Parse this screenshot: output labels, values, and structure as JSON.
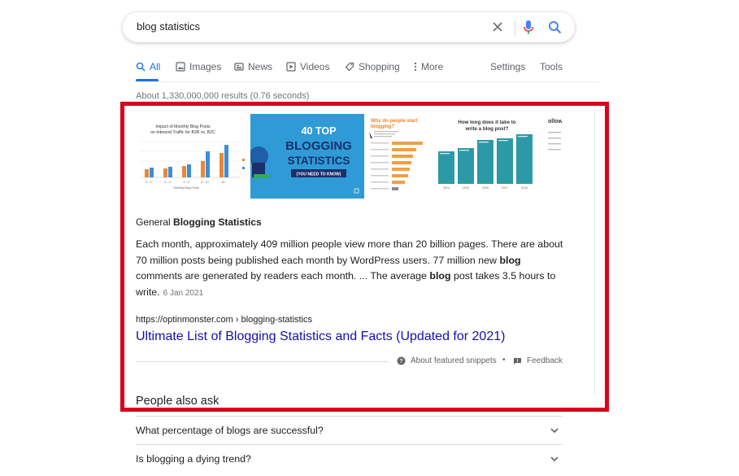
{
  "search": {
    "query": "blog statistics"
  },
  "tabs": [
    {
      "label": "All",
      "icon": "search-icon"
    },
    {
      "label": "Images",
      "icon": "image-icon"
    },
    {
      "label": "News",
      "icon": "news-icon"
    },
    {
      "label": "Videos",
      "icon": "video-icon"
    },
    {
      "label": "Shopping",
      "icon": "tag-icon"
    },
    {
      "label": "More",
      "icon": "more-vert-icon"
    }
  ],
  "tools": {
    "settings": "Settings",
    "tools": "Tools"
  },
  "result_stats": "About 1,330,000,000 results (0.76 seconds)",
  "images": {
    "img1": {
      "title_line1": "Impact of Monthly Blog Posts",
      "title_line2": "on Inbound Traffic for B2B vs. B2C",
      "xlabels": [
        "0 - 1",
        "2 - 3",
        "4 - 5",
        "6 - 10",
        "11+"
      ],
      "xaxis": "Monthly Blog Posts"
    },
    "img2": {
      "line1": "40 TOP",
      "line2": "BLOGGING",
      "line3": "STATISTICS",
      "line4": "(YOU NEED TO KNOW)"
    },
    "img3": {
      "title_line1": "Why do people start",
      "title_line2": "blogging?"
    },
    "img4": {
      "title_line1": "How long does it take to",
      "title_line2": "write a blog post?",
      "years": [
        "2014",
        "2015",
        "2016",
        "2017",
        "2018"
      ]
    },
    "img5": {
      "text": "ollow"
    }
  },
  "snippet": {
    "heading_prefix": "General ",
    "heading_bold": "Blogging Statistics",
    "body_1": "Each month, approximately 409 million people view more than 20 billion pages. There are about 70 million posts being published each month by WordPress users. 77 million new ",
    "bold_1": "blog",
    "body_2": " comments are generated by readers each month. ... The average ",
    "bold_2": "blog",
    "body_3": " post takes 3.5 hours to write.",
    "date": "6 Jan 2021"
  },
  "result": {
    "url": "https://optinmonster.com › blogging-statistics",
    "title": "Ultimate List of Blogging Statistics and Facts (Updated for 2021)"
  },
  "footer": {
    "about": "About featured snippets",
    "separator": "•",
    "feedback": "Feedback"
  },
  "paa": {
    "heading": "People also ask",
    "questions": [
      "What percentage of blogs are successful?",
      "Is blogging a dying trend?"
    ]
  },
  "colors": {
    "accent": "#1a73e8",
    "link": "#1a0dab",
    "highlight": "#d9001b",
    "teal": "#2b9aa6"
  }
}
